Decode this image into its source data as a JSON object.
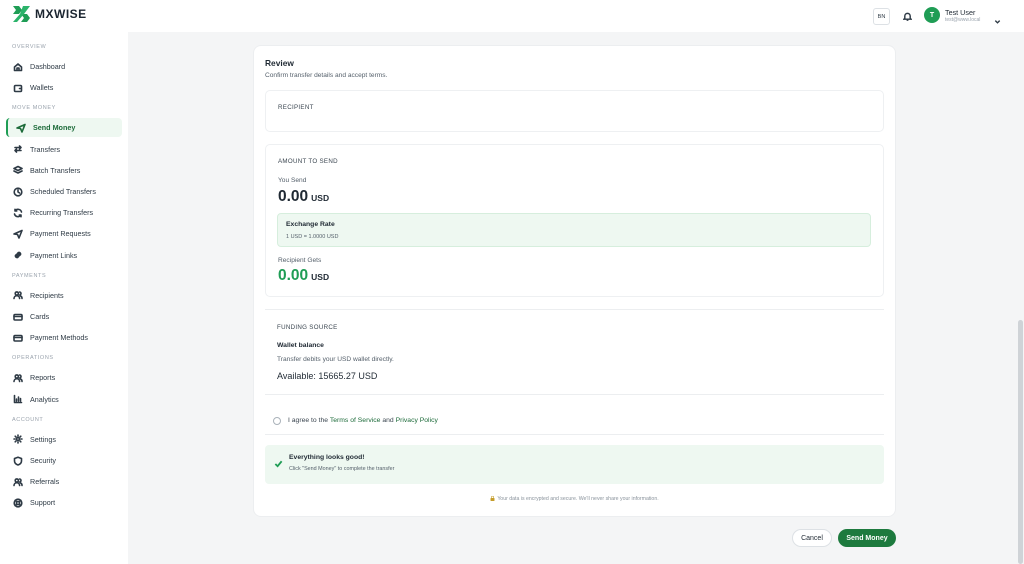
{
  "brand": {
    "name": "MXWISE",
    "color": "#1f9d55"
  },
  "sidebar": {
    "sections": [
      {
        "label": "OVERVIEW",
        "items": [
          {
            "label": "Dashboard",
            "icon": "home-icon"
          },
          {
            "label": "Wallets",
            "icon": "wallet-icon"
          }
        ]
      },
      {
        "label": "MOVE MONEY",
        "items": [
          {
            "label": "Send Money",
            "icon": "send-icon",
            "active": true
          },
          {
            "label": "Transfers",
            "icon": "transfer-arrows-icon"
          },
          {
            "label": "Batch Transfers",
            "icon": "layers-icon"
          },
          {
            "label": "Scheduled Transfers",
            "icon": "clock-icon"
          },
          {
            "label": "Recurring Transfers",
            "icon": "refresh-icon"
          },
          {
            "label": "Payment Requests",
            "icon": "send-icon"
          },
          {
            "label": "Payment Links",
            "icon": "link-icon"
          }
        ]
      },
      {
        "label": "PAYMENTS",
        "items": [
          {
            "label": "Recipients",
            "icon": "users-icon"
          },
          {
            "label": "Cards",
            "icon": "card-icon"
          },
          {
            "label": "Payment Methods",
            "icon": "card-icon"
          }
        ]
      },
      {
        "label": "OPERATIONS",
        "items": [
          {
            "label": "Reports",
            "icon": "users-icon"
          },
          {
            "label": "Analytics",
            "icon": "bar-chart-icon"
          }
        ]
      },
      {
        "label": "ACCOUNT",
        "items": [
          {
            "label": "Settings",
            "icon": "gear-icon"
          },
          {
            "label": "Security",
            "icon": "shield-icon"
          },
          {
            "label": "Referrals",
            "icon": "users-icon"
          },
          {
            "label": "Support",
            "icon": "lifebuoy-icon"
          }
        ]
      }
    ]
  },
  "header": {
    "lang": "BN",
    "user": {
      "initial": "T",
      "name": "Test User",
      "email": "test@www.local"
    }
  },
  "review": {
    "title": "Review",
    "subtitle": "Confirm transfer details and accept terms.",
    "recipient_label": "RECIPIENT",
    "amount_label": "AMOUNT TO SEND",
    "you_send_label": "You Send",
    "you_send_value": "0.00",
    "you_send_currency": "USD",
    "rate_title": "Exchange Rate",
    "rate_value": "1 USD = 1.0000 USD",
    "recipient_gets_label": "Recipient Gets",
    "recipient_gets_value": "0.00",
    "recipient_gets_currency": "USD",
    "funding_label": "FUNDING SOURCE",
    "wallet_title": "Wallet balance",
    "wallet_desc": "Transfer debits your USD wallet directly.",
    "available": "Available: 15665.27 USD",
    "agree_prefix": "I agree to the ",
    "terms_link": "Terms of Service",
    "agree_and": " and ",
    "privacy_link": "Privacy Policy",
    "ok_title": "Everything looks good!",
    "ok_sub": "Click \"Send Money\" to complete the transfer",
    "secure_note": "Your data is encrypted and secure. We'll never share your information."
  },
  "actions": {
    "cancel": "Cancel",
    "send": "Send Money"
  }
}
